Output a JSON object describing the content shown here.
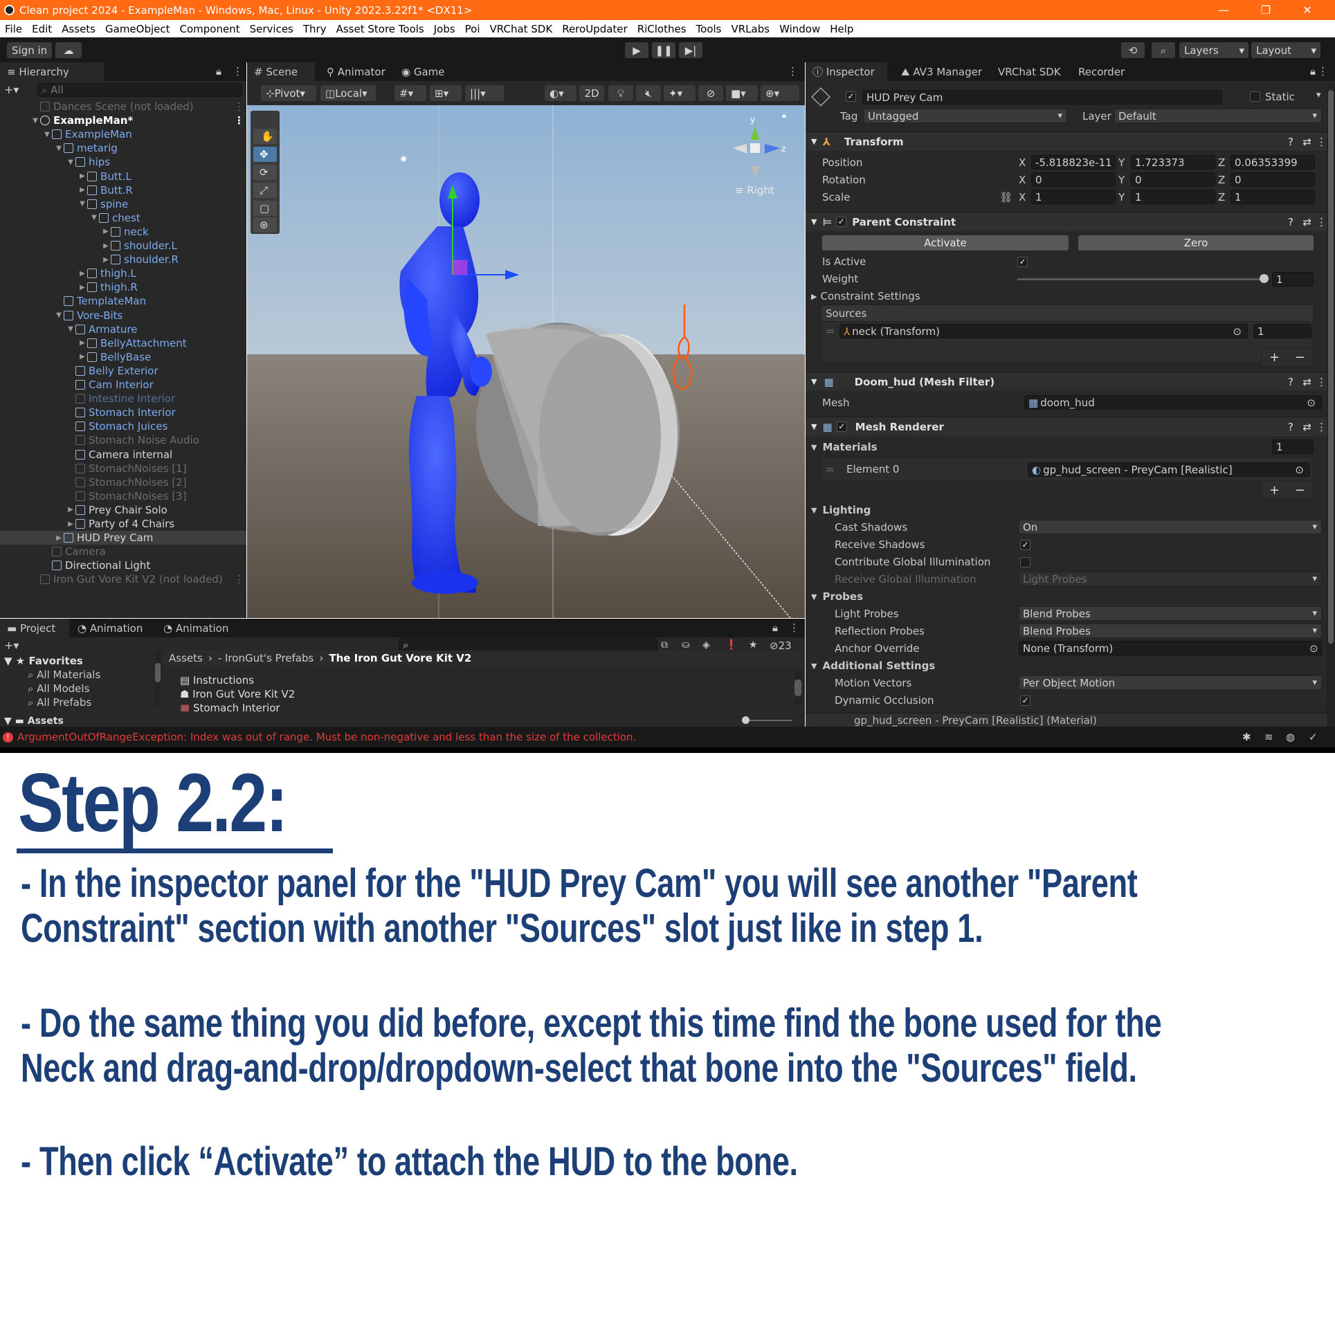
{
  "window": {
    "title": "Clean project 2024 - ExampleMan - Windows, Mac, Linux - Unity 2022.3.22f1* <DX11>",
    "controls": [
      "—",
      "❐",
      "✕"
    ]
  },
  "menu": [
    "File",
    "Edit",
    "Assets",
    "GameObject",
    "Component",
    "Services",
    "Thry",
    "Asset Store Tools",
    "Jobs",
    "Poi",
    "VRChat SDK",
    "ReroUpdater",
    "RiClothes",
    "Tools",
    "VRLabs",
    "Window",
    "Help"
  ],
  "toolbar": {
    "sign_in": "Sign in",
    "layers": "Layers",
    "layout": "Layout"
  },
  "hierarchy": {
    "tab": "Hierarchy",
    "search_placeholder": "All",
    "rows": [
      {
        "label": "Dances Scene (not loaded)",
        "indent": 0,
        "style": "dim",
        "arrow": ""
      },
      {
        "label": "ExampleMan*",
        "indent": 0,
        "style": "bold",
        "arrow": "▼"
      },
      {
        "label": "ExampleMan",
        "indent": 1,
        "style": "blue",
        "arrow": "▼"
      },
      {
        "label": "metarig",
        "indent": 2,
        "style": "blue",
        "arrow": "▼"
      },
      {
        "label": "hips",
        "indent": 3,
        "style": "blue",
        "arrow": "▼"
      },
      {
        "label": "Butt.L",
        "indent": 4,
        "style": "blue",
        "arrow": "▶"
      },
      {
        "label": "Butt.R",
        "indent": 4,
        "style": "blue",
        "arrow": "▶"
      },
      {
        "label": "spine",
        "indent": 4,
        "style": "blue",
        "arrow": "▼"
      },
      {
        "label": "chest",
        "indent": 5,
        "style": "blue",
        "arrow": "▼"
      },
      {
        "label": "neck",
        "indent": 6,
        "style": "blue",
        "arrow": "▶"
      },
      {
        "label": "shoulder.L",
        "indent": 6,
        "style": "blue",
        "arrow": "▶"
      },
      {
        "label": "shoulder.R",
        "indent": 6,
        "style": "blue",
        "arrow": "▶"
      },
      {
        "label": "thigh.L",
        "indent": 4,
        "style": "blue",
        "arrow": "▶"
      },
      {
        "label": "thigh.R",
        "indent": 4,
        "style": "blue",
        "arrow": "▶"
      },
      {
        "label": "TemplateMan",
        "indent": 2,
        "style": "blue",
        "arrow": ""
      },
      {
        "label": "Vore-Bits",
        "indent": 2,
        "style": "blue",
        "arrow": "▼"
      },
      {
        "label": "Armature",
        "indent": 3,
        "style": "blue",
        "arrow": "▼"
      },
      {
        "label": "BellyAttachment",
        "indent": 4,
        "style": "blue",
        "arrow": "▶"
      },
      {
        "label": "BellyBase",
        "indent": 4,
        "style": "blue",
        "arrow": "▶"
      },
      {
        "label": "Belly Exterior",
        "indent": 3,
        "style": "blue",
        "arrow": ""
      },
      {
        "label": "Cam Interior",
        "indent": 3,
        "style": "blue",
        "arrow": ""
      },
      {
        "label": "Intestine Interior",
        "indent": 3,
        "style": "dimblue",
        "arrow": ""
      },
      {
        "label": "Stomach Interior",
        "indent": 3,
        "style": "blue",
        "arrow": ""
      },
      {
        "label": "Stomach Juices",
        "indent": 3,
        "style": "blue",
        "arrow": ""
      },
      {
        "label": "Stomach Noise Audio",
        "indent": 3,
        "style": "dim",
        "arrow": ""
      },
      {
        "label": "Camera internal",
        "indent": 3,
        "style": "white",
        "arrow": ""
      },
      {
        "label": "StomachNoises [1]",
        "indent": 3,
        "style": "dim",
        "arrow": ""
      },
      {
        "label": "StomachNoises [2]",
        "indent": 3,
        "style": "dim",
        "arrow": ""
      },
      {
        "label": "StomachNoises [3]",
        "indent": 3,
        "style": "dim",
        "arrow": ""
      },
      {
        "label": "Prey Chair Solo",
        "indent": 3,
        "style": "white",
        "arrow": "▶"
      },
      {
        "label": "Party of 4 Chairs",
        "indent": 3,
        "style": "white",
        "arrow": "▶"
      },
      {
        "label": "HUD Prey Cam",
        "indent": 2,
        "style": "white",
        "arrow": "▶"
      },
      {
        "label": "Camera",
        "indent": 1,
        "style": "dim",
        "arrow": ""
      },
      {
        "label": "Directional Light",
        "indent": 1,
        "style": "white",
        "arrow": ""
      },
      {
        "label": "Iron Gut Vore Kit V2 (not loaded)",
        "indent": 0,
        "style": "dim",
        "arrow": ""
      }
    ]
  },
  "scene": {
    "tabs": [
      "Scene",
      "Animator",
      "Game"
    ],
    "pivot": "Pivot",
    "local": "Local",
    "mode_2d": "2D",
    "gizmo_label": "Right",
    "axis_x": "x",
    "axis_y": "y",
    "axis_z": "z"
  },
  "inspector": {
    "tabs": [
      "Inspector",
      "AV3 Manager",
      "VRChat SDK",
      "Recorder"
    ],
    "object_name": "HUD Prey Cam",
    "static_label": "Static",
    "tag_label": "Tag",
    "tag_value": "Untagged",
    "layer_label": "Layer",
    "layer_value": "Default",
    "transform": {
      "title": "Transform",
      "position_label": "Position",
      "rotation_label": "Rotation",
      "scale_label": "Scale",
      "position": [
        "-5.818823e-11",
        "1.723373",
        "0.06353399"
      ],
      "rotation": [
        "0",
        "0",
        "0"
      ],
      "scale": [
        "1",
        "1",
        "1"
      ],
      "x": "X",
      "y": "Y",
      "z": "Z"
    },
    "parent_constraint": {
      "title": "Parent Constraint",
      "activate": "Activate",
      "zero": "Zero",
      "is_active_label": "Is Active",
      "weight_label": "Weight",
      "weight_value": "1",
      "settings_label": "Constraint Settings",
      "sources_label": "Sources",
      "source_name": "neck (Transform)",
      "source_weight": "1"
    },
    "mesh_filter": {
      "title": "Doom_hud (Mesh Filter)",
      "mesh_label": "Mesh",
      "mesh_value": "doom_hud"
    },
    "mesh_renderer": {
      "title": "Mesh Renderer",
      "materials_label": "Materials",
      "materials_count": "1",
      "element_label": "Element 0",
      "element_value": "gp_hud_screen - PreyCam [Realistic]",
      "lighting_label": "Lighting",
      "cast_shadows_label": "Cast Shadows",
      "cast_shadows_value": "On",
      "receive_shadows_label": "Receive Shadows",
      "contribute_gi_label": "Contribute Global Illumination",
      "receive_gi_label": "Receive Global Illumination",
      "receive_gi_value": "Light Probes",
      "probes_label": "Probes",
      "light_probes_label": "Light Probes",
      "light_probes_value": "Blend Probes",
      "reflection_probes_label": "Reflection Probes",
      "reflection_probes_value": "Blend Probes",
      "anchor_override_label": "Anchor Override",
      "anchor_override_value": "None (Transform)",
      "additional_label": "Additional Settings",
      "motion_vectors_label": "Motion Vectors",
      "motion_vectors_value": "Per Object Motion",
      "dynamic_occlusion_label": "Dynamic Occlusion"
    },
    "material_footer": "gp_hud_screen - PreyCam [Realistic] (Material)"
  },
  "project": {
    "tabs": [
      "Project",
      "Animation",
      "Animation"
    ],
    "hidden_count": "23",
    "favorites_label": "Favorites",
    "favorites": [
      "All Materials",
      "All Models",
      "All Prefabs"
    ],
    "assets_label": "Assets",
    "breadcrumb": [
      "Assets",
      "- IronGut's Prefabs",
      "The Iron Gut Vore Kit V2"
    ],
    "files": [
      "Instructions",
      "Iron Gut Vore Kit V2",
      "Stomach Interior"
    ]
  },
  "status": {
    "error": "ArgumentOutOfRangeException: Index was out of range. Must be non-negative and less than the size of the collection."
  },
  "instructions": {
    "title": "Step 2.2:",
    "lines": [
      "- In the inspector panel for the \"HUD Prey Cam\" you will see another \"Parent",
      "Constraint\" section with another \"Sources\" slot just like in step 1.",
      "- Do the same thing you did before, except this time find the bone used for the",
      "Neck and drag-and-drop/dropdown-select that bone into the \"Sources\" field.",
      "- Then click “Activate” to attach the HUD to the bone."
    ]
  },
  "colors": {
    "title_bar": "#ff6a13",
    "hierarchy_blue": "#7dabf0",
    "instruction_blue": "#1d3f77",
    "error_red": "#e03c3c",
    "sky": "#8aaac9",
    "ground": "#5e554c",
    "avatar_blue": "#1f3dff"
  }
}
